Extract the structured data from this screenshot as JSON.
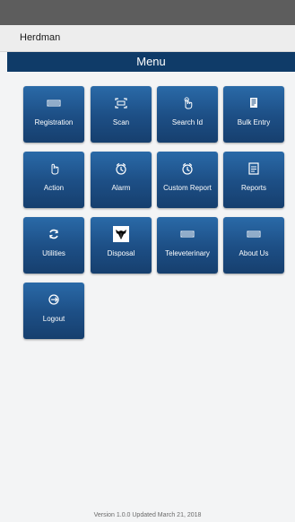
{
  "app": {
    "title": "Herdman"
  },
  "menu": {
    "header": "Menu",
    "tiles": [
      {
        "label": "Registration",
        "icon": "barcode-icon"
      },
      {
        "label": "Scan",
        "icon": "scan-icon"
      },
      {
        "label": "Search Id",
        "icon": "tap-icon"
      },
      {
        "label": "Bulk Entry",
        "icon": "bulk-entry-icon"
      },
      {
        "label": "Action",
        "icon": "hand-icon"
      },
      {
        "label": "Alarm",
        "icon": "alarm-icon"
      },
      {
        "label": "Custom Report",
        "icon": "alarm-icon"
      },
      {
        "label": "Reports",
        "icon": "report-icon"
      },
      {
        "label": "Utilities",
        "icon": "refresh-icon"
      },
      {
        "label": "Disposal",
        "icon": "cow-icon"
      },
      {
        "label": "Televeterinary",
        "icon": "barcode-icon"
      },
      {
        "label": "About Us",
        "icon": "barcode-icon"
      },
      {
        "label": "Logout",
        "icon": "logout-icon"
      }
    ]
  },
  "footer": {
    "version_text": "Version 1.0.0 Updated March 21, 2018"
  }
}
